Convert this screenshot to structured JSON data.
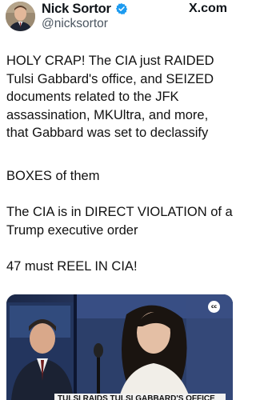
{
  "author": {
    "display_name": "Nick Sortor",
    "handle": "@nicksortor",
    "verified": true
  },
  "source": {
    "label": "X.com"
  },
  "tweet": {
    "paragraphs": [
      [
        "HOLY CRAP! The CIA just RAIDED",
        "Tulsi Gabbard's office, and SEIZED",
        "documents related to the JFK",
        "assassination, MKUltra, and more,",
        "that Gabbard was set to declassify"
      ],
      [
        "BOXES of them"
      ],
      [
        "The CIA is in DIRECT VIOLATION of a",
        "Trump executive order"
      ],
      [
        "47 must REEL IN CIA!"
      ]
    ]
  },
  "media": {
    "badge": "cc",
    "chyron": "TULSI RAIDS TULSI GABBARD'S OFFICE"
  },
  "colors": {
    "verified_badge": "#1d9bf0",
    "text": "#0f1419",
    "handle": "#4a5560",
    "media_bg": "#1c2a4a"
  }
}
